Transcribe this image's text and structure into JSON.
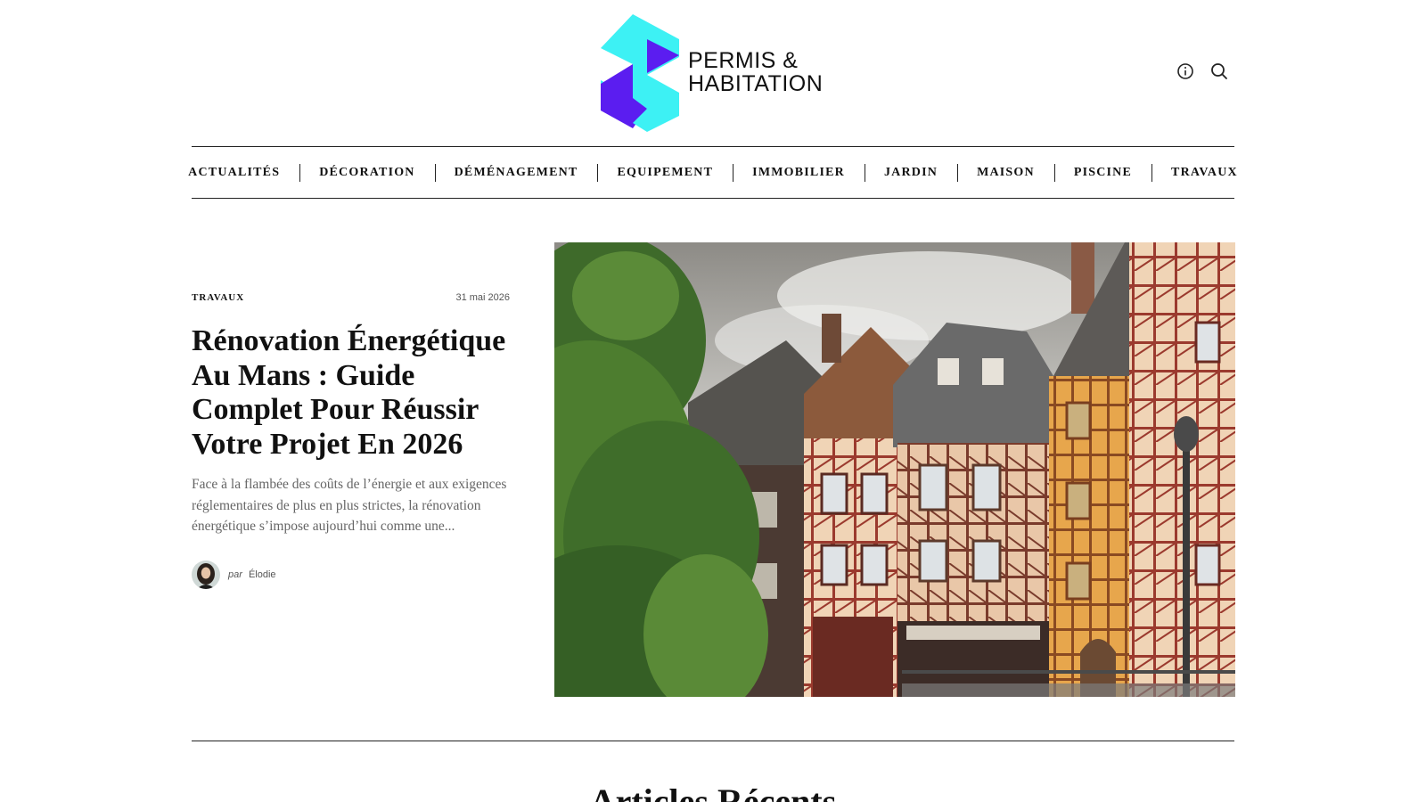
{
  "brand": {
    "line1": "PERMIS &",
    "line2": "HABITATION",
    "colors": {
      "cyan": "#3df1f4",
      "purple": "#5b1df0"
    }
  },
  "header": {
    "icons": [
      "info-icon",
      "search-icon"
    ]
  },
  "nav": {
    "items": [
      "ACTUALITÉS",
      "DÉCORATION",
      "DÉMÉNAGEMENT",
      "EQUIPEMENT",
      "IMMOBILIER",
      "JARDIN",
      "MAISON",
      "PISCINE",
      "TRAVAUX"
    ]
  },
  "featured": {
    "category": "TRAVAUX",
    "date": "31 mai 2026",
    "title": "Rénovation Énergétique Au Mans : Guide Complet Pour Réussir Votre Projet En 2026",
    "excerpt": "Face à la flambée des coûts de l’énergie et aux exigences réglementaires de plus en plus strictes, la rénovation énergétique s’impose aujourd’hui comme une...",
    "author_prefix": "par",
    "author_name": "Élodie"
  },
  "sections": {
    "recent_title": "Articles Récents"
  }
}
